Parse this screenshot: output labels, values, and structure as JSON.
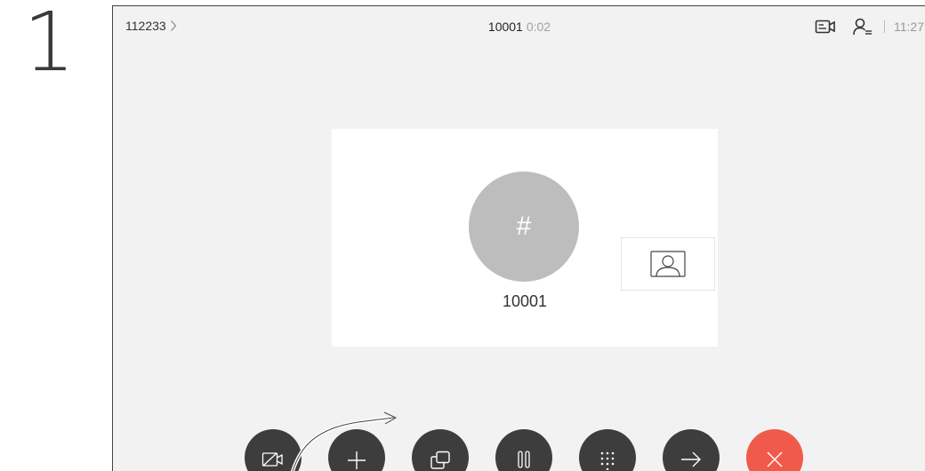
{
  "step_number": "1",
  "topbar": {
    "breadcrumb": "112233",
    "callee": "10001",
    "duration": "0:02",
    "time": "11:27",
    "icons": [
      "chevron-right-icon",
      "video-camera-icon",
      "participants-icon"
    ]
  },
  "call": {
    "avatar_glyph": "#",
    "callee_name": "10001",
    "selfview_icon": "person-icon"
  },
  "controls": {
    "buttons": [
      {
        "name": "camera-off-button",
        "icon": "camera-off-icon"
      },
      {
        "name": "add-participant-button",
        "icon": "plus-icon"
      },
      {
        "name": "share-button",
        "icon": "share-screen-icon"
      },
      {
        "name": "hold-button",
        "icon": "pause-icon"
      },
      {
        "name": "keypad-button",
        "icon": "keypad-icon"
      },
      {
        "name": "transfer-button",
        "icon": "arrow-right-icon"
      },
      {
        "name": "end-call-button",
        "icon": "close-icon"
      }
    ],
    "end_call_color": "#f15a4a",
    "button_color": "#3d3d3d"
  }
}
